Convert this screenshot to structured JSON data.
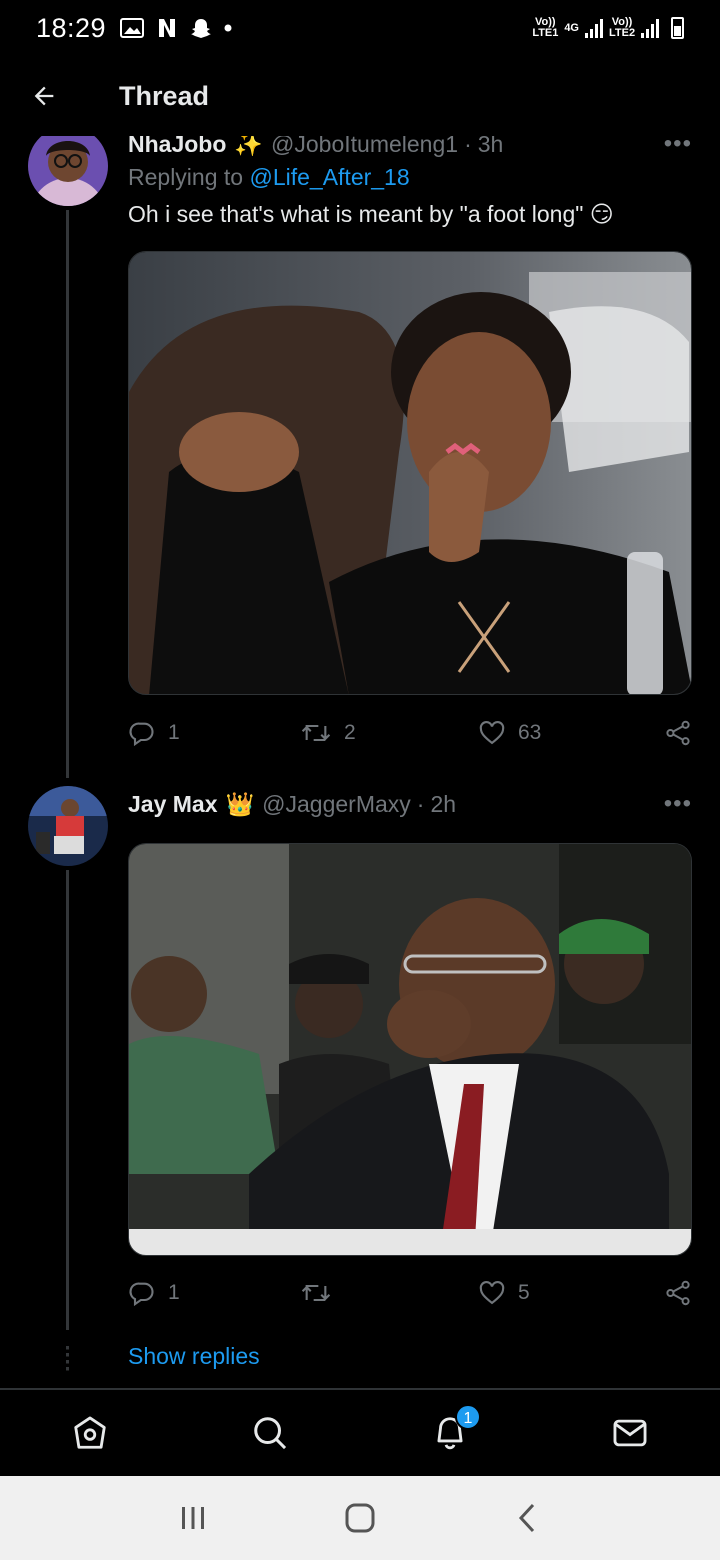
{
  "status_bar": {
    "time": "18:29",
    "sim1": "Vo)) LTE1",
    "net": "4G",
    "sim2": "Vo)) LTE2",
    "left_icons": [
      "gallery-icon",
      "netflix-icon",
      "snapchat-icon",
      "dot-icon"
    ]
  },
  "header": {
    "title": "Thread"
  },
  "tweets": [
    {
      "display_name": "NhaJobo",
      "emoji": "✨",
      "handle": "@JoboItumeleng1",
      "time": "3h",
      "replying_prefix": "Replying to",
      "replying_handle": "@Life_After_18",
      "text": "Oh i see that's what is meant by \"a foot long\" 😏",
      "replies": "1",
      "retweets": "2",
      "likes": "63"
    },
    {
      "display_name": "Jay Max",
      "emoji": "👑",
      "handle": "@JaggerMaxy",
      "time": "2h",
      "replies": "1",
      "retweets": "",
      "likes": "5"
    }
  ],
  "show_replies": "Show replies",
  "bottom_nav": {
    "items": [
      "home-icon",
      "search-icon",
      "notifications-icon",
      "messages-icon"
    ],
    "notification_badge": "1"
  },
  "colors": {
    "accent": "#1d9bf0",
    "muted": "#71767b",
    "background": "#000000"
  }
}
